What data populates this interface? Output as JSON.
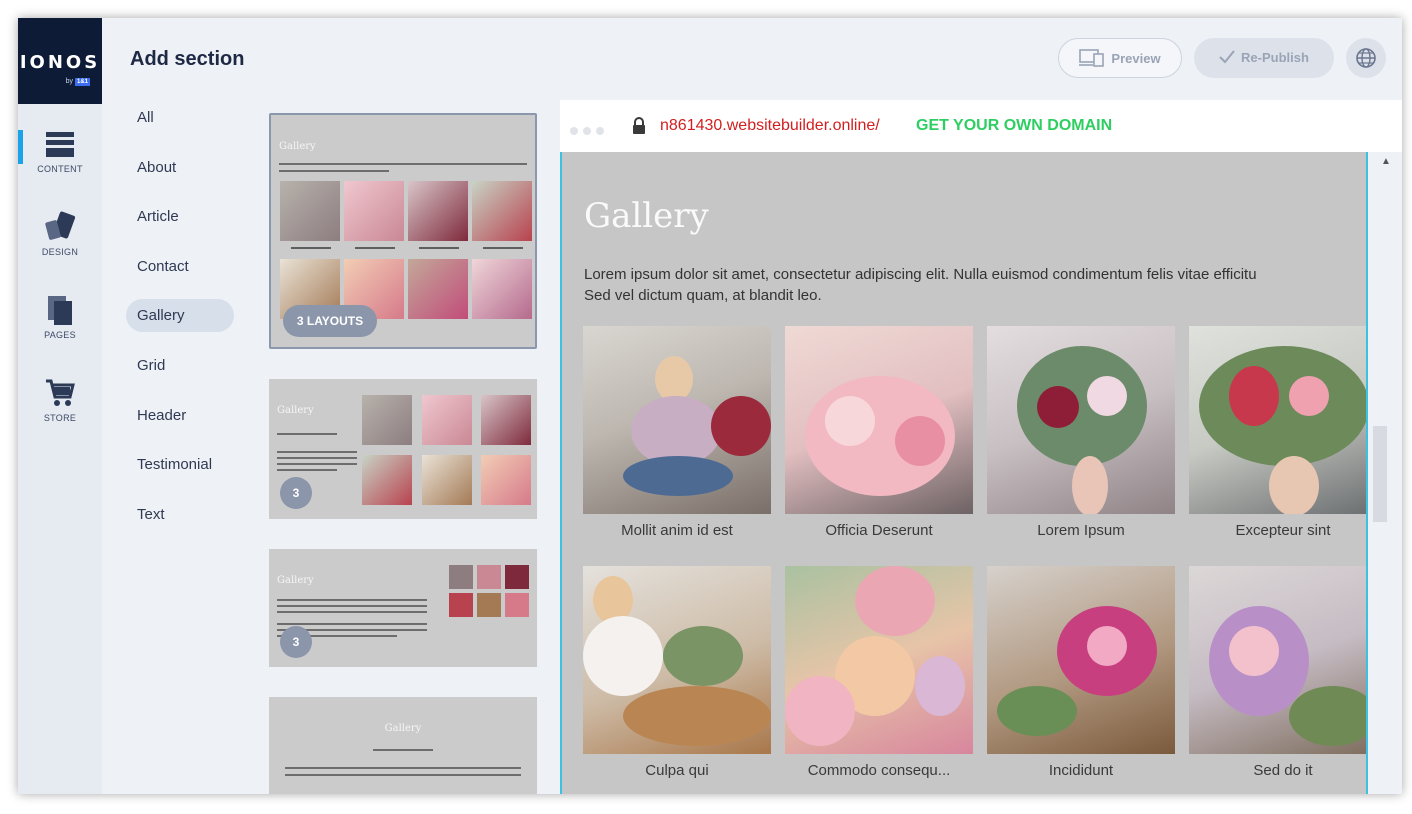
{
  "brand": {
    "logo": "IONOS",
    "by": "by",
    "mark": "1&1"
  },
  "rail": [
    {
      "label": "CONTENT",
      "icon": "content-icon"
    },
    {
      "label": "DESIGN",
      "icon": "design-icon"
    },
    {
      "label": "PAGES",
      "icon": "pages-icon"
    },
    {
      "label": "STORE",
      "icon": "cart-icon"
    }
  ],
  "panel": {
    "title": "Add section",
    "categories": [
      "All",
      "About",
      "Article",
      "Contact",
      "Gallery",
      "Grid",
      "Header",
      "Testimonial",
      "Text"
    ],
    "active_category": "Gallery"
  },
  "thumbnails": [
    {
      "title": "Gallery",
      "badge": "3 LAYOUTS",
      "captions": [
        "Mollit anim id est",
        "Officia Deserunt",
        "Lorem ipsum",
        "Excepteur sint"
      ]
    },
    {
      "title": "Gallery",
      "subtitle": "Nullam eget malesuada risus",
      "badge": "3"
    },
    {
      "title": "Gallery",
      "badge": "3"
    },
    {
      "title": "Gallery",
      "subtitle": "Lorem ipsum dolor"
    }
  ],
  "toolbar": {
    "preview": "Preview",
    "republish": "Re-Publish"
  },
  "browser": {
    "url": "n861430.websitebuilder.online/",
    "domain_cta": "GET YOUR OWN DOMAIN"
  },
  "site": {
    "title": "Gallery",
    "text": "Lorem ipsum dolor sit amet, consectetur adipiscing elit. Nulla euismod condimentum felis vitae efficitur. Sed vel dictum quam, at blandit leo.",
    "text_line1": "Lorem ipsum dolor sit amet, consectetur adipiscing elit. Nulla euismod condimentum felis vitae efficitu",
    "text_line2": "Sed vel dictum quam, at blandit leo.",
    "items": [
      {
        "caption": "Mollit anim id est"
      },
      {
        "caption": "Officia Deserunt"
      },
      {
        "caption": "Lorem Ipsum"
      },
      {
        "caption": "Excepteur sint"
      },
      {
        "caption": "Culpa qui"
      },
      {
        "caption": "Commodo consequ..."
      },
      {
        "caption": "Incididunt"
      },
      {
        "caption": "Sed do it"
      }
    ]
  },
  "colors": {
    "accent": "#1aa3e8",
    "url": "#d21f1f",
    "cta": "#2fce62",
    "navy": "#0d1b36"
  }
}
